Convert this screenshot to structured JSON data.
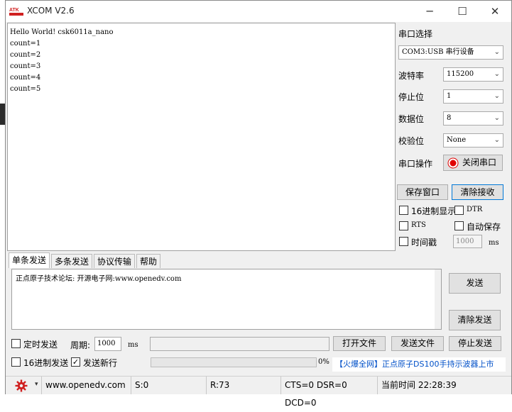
{
  "window": {
    "title": "XCOM V2.6",
    "logo_text": "ATK",
    "minimize_icon": "─",
    "maximize_icon": "☐",
    "close_icon": "✕"
  },
  "receive": {
    "lines": [
      "Hello World! csk6011a_nano",
      "count=1",
      "count=2",
      "count=3",
      "count=4",
      "count=5"
    ]
  },
  "settings": {
    "port_select_label": "串口选择",
    "port_value": "COM3:USB 串行设备",
    "baud_label": "波特率",
    "baud_value": "115200",
    "stop_label": "停止位",
    "stop_value": "1",
    "data_label": "数据位",
    "data_value": "8",
    "parity_label": "校验位",
    "parity_value": "None",
    "port_op_label": "串口操作",
    "close_port_label": "关闭串口"
  },
  "actions": {
    "save_window": "保存窗口",
    "clear_receive": "清除接收"
  },
  "options": {
    "hex_display": "16进制显示",
    "dtr": "DTR",
    "rts": "RTS",
    "auto_save": "自动保存",
    "timestamp": "时间戳",
    "timestamp_ms_value": "1000",
    "ms_unit": "ms"
  },
  "tabs": [
    "单条发送",
    "多条发送",
    "协议传输",
    "帮助"
  ],
  "send": {
    "text": "正点原子技术论坛: 开源电子网:www.openedv.com",
    "send_button": "发送",
    "clear_send_button": "清除发送",
    "timed_send_label": "定时发送",
    "period_label": "周期:",
    "period_value": "1000",
    "period_unit": "ms",
    "open_file": "打开文件",
    "send_file": "发送文件",
    "stop_send": "停止发送",
    "hex_send_label": "16进制发送",
    "send_newline_label": "发送新行",
    "progress_text": "0%",
    "progress_value": 0,
    "ad_text": "【火爆全网】正点原子DS100手持示波器上市"
  },
  "status": {
    "website": "www.openedv.com",
    "sent": "S:0",
    "received": "R:73",
    "signals": "CTS=0 DSR=0 DCD=0",
    "time": "当前时间 22:28:39"
  },
  "colors": {
    "accent": "#0078d7",
    "record_red": "#e00000",
    "gear_red": "#d02020",
    "ad_blue": "#0050c8"
  }
}
